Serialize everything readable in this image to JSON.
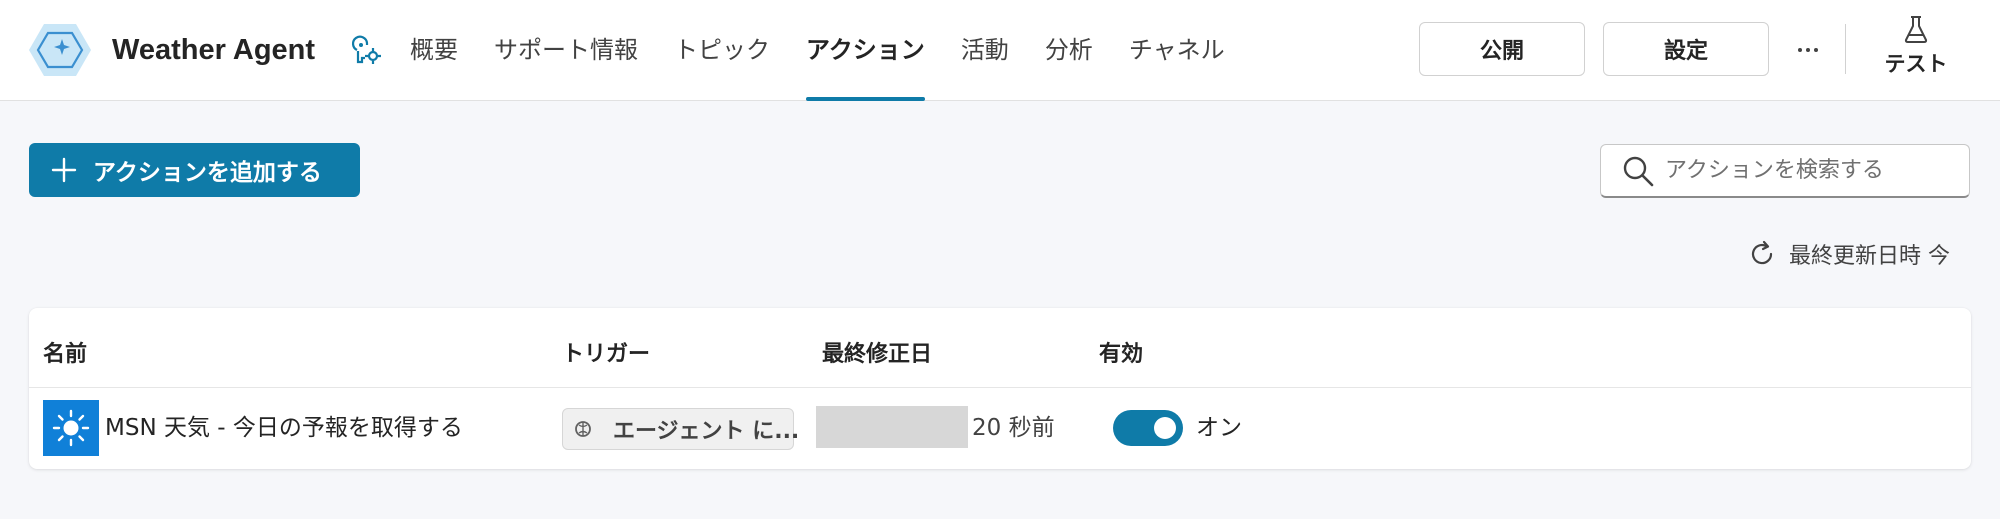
{
  "header": {
    "agent_name": "Weather Agent",
    "tabs": [
      {
        "label": "概要",
        "active": false
      },
      {
        "label": "サポート情報",
        "active": false
      },
      {
        "label": "トピック",
        "active": false
      },
      {
        "label": "アクション",
        "active": true
      },
      {
        "label": "活動",
        "active": false
      },
      {
        "label": "分析",
        "active": false
      },
      {
        "label": "チャネル",
        "active": false
      }
    ],
    "publish_label": "公開",
    "settings_label": "設定",
    "test_label": "テスト"
  },
  "toolbar": {
    "add_action_label": "アクションを追加する",
    "search_placeholder": "アクションを検索する",
    "last_updated": "最終更新日時 今"
  },
  "table": {
    "columns": [
      "名前",
      "トリガー",
      "最終修正日",
      "有効"
    ],
    "rows": [
      {
        "name": "MSN 天気 - 今日の予報を取得する",
        "trigger": "エージェント に...",
        "modified": "20 秒前",
        "enabled": true,
        "enabled_label": "オン"
      }
    ]
  },
  "colors": {
    "accent": "#0f7ba8",
    "action_icon_bg": "#1080d8",
    "page_bg": "#f6f7fa"
  },
  "icons": {
    "logo": "hexagon-sparkle-icon",
    "agent_settings": "key-gear-icon",
    "more": "ellipsis-icon",
    "test": "flask-icon",
    "add": "plus-icon",
    "search": "search-icon",
    "refresh": "refresh-icon",
    "action": "sun-icon",
    "trigger": "ai-brain-icon"
  }
}
